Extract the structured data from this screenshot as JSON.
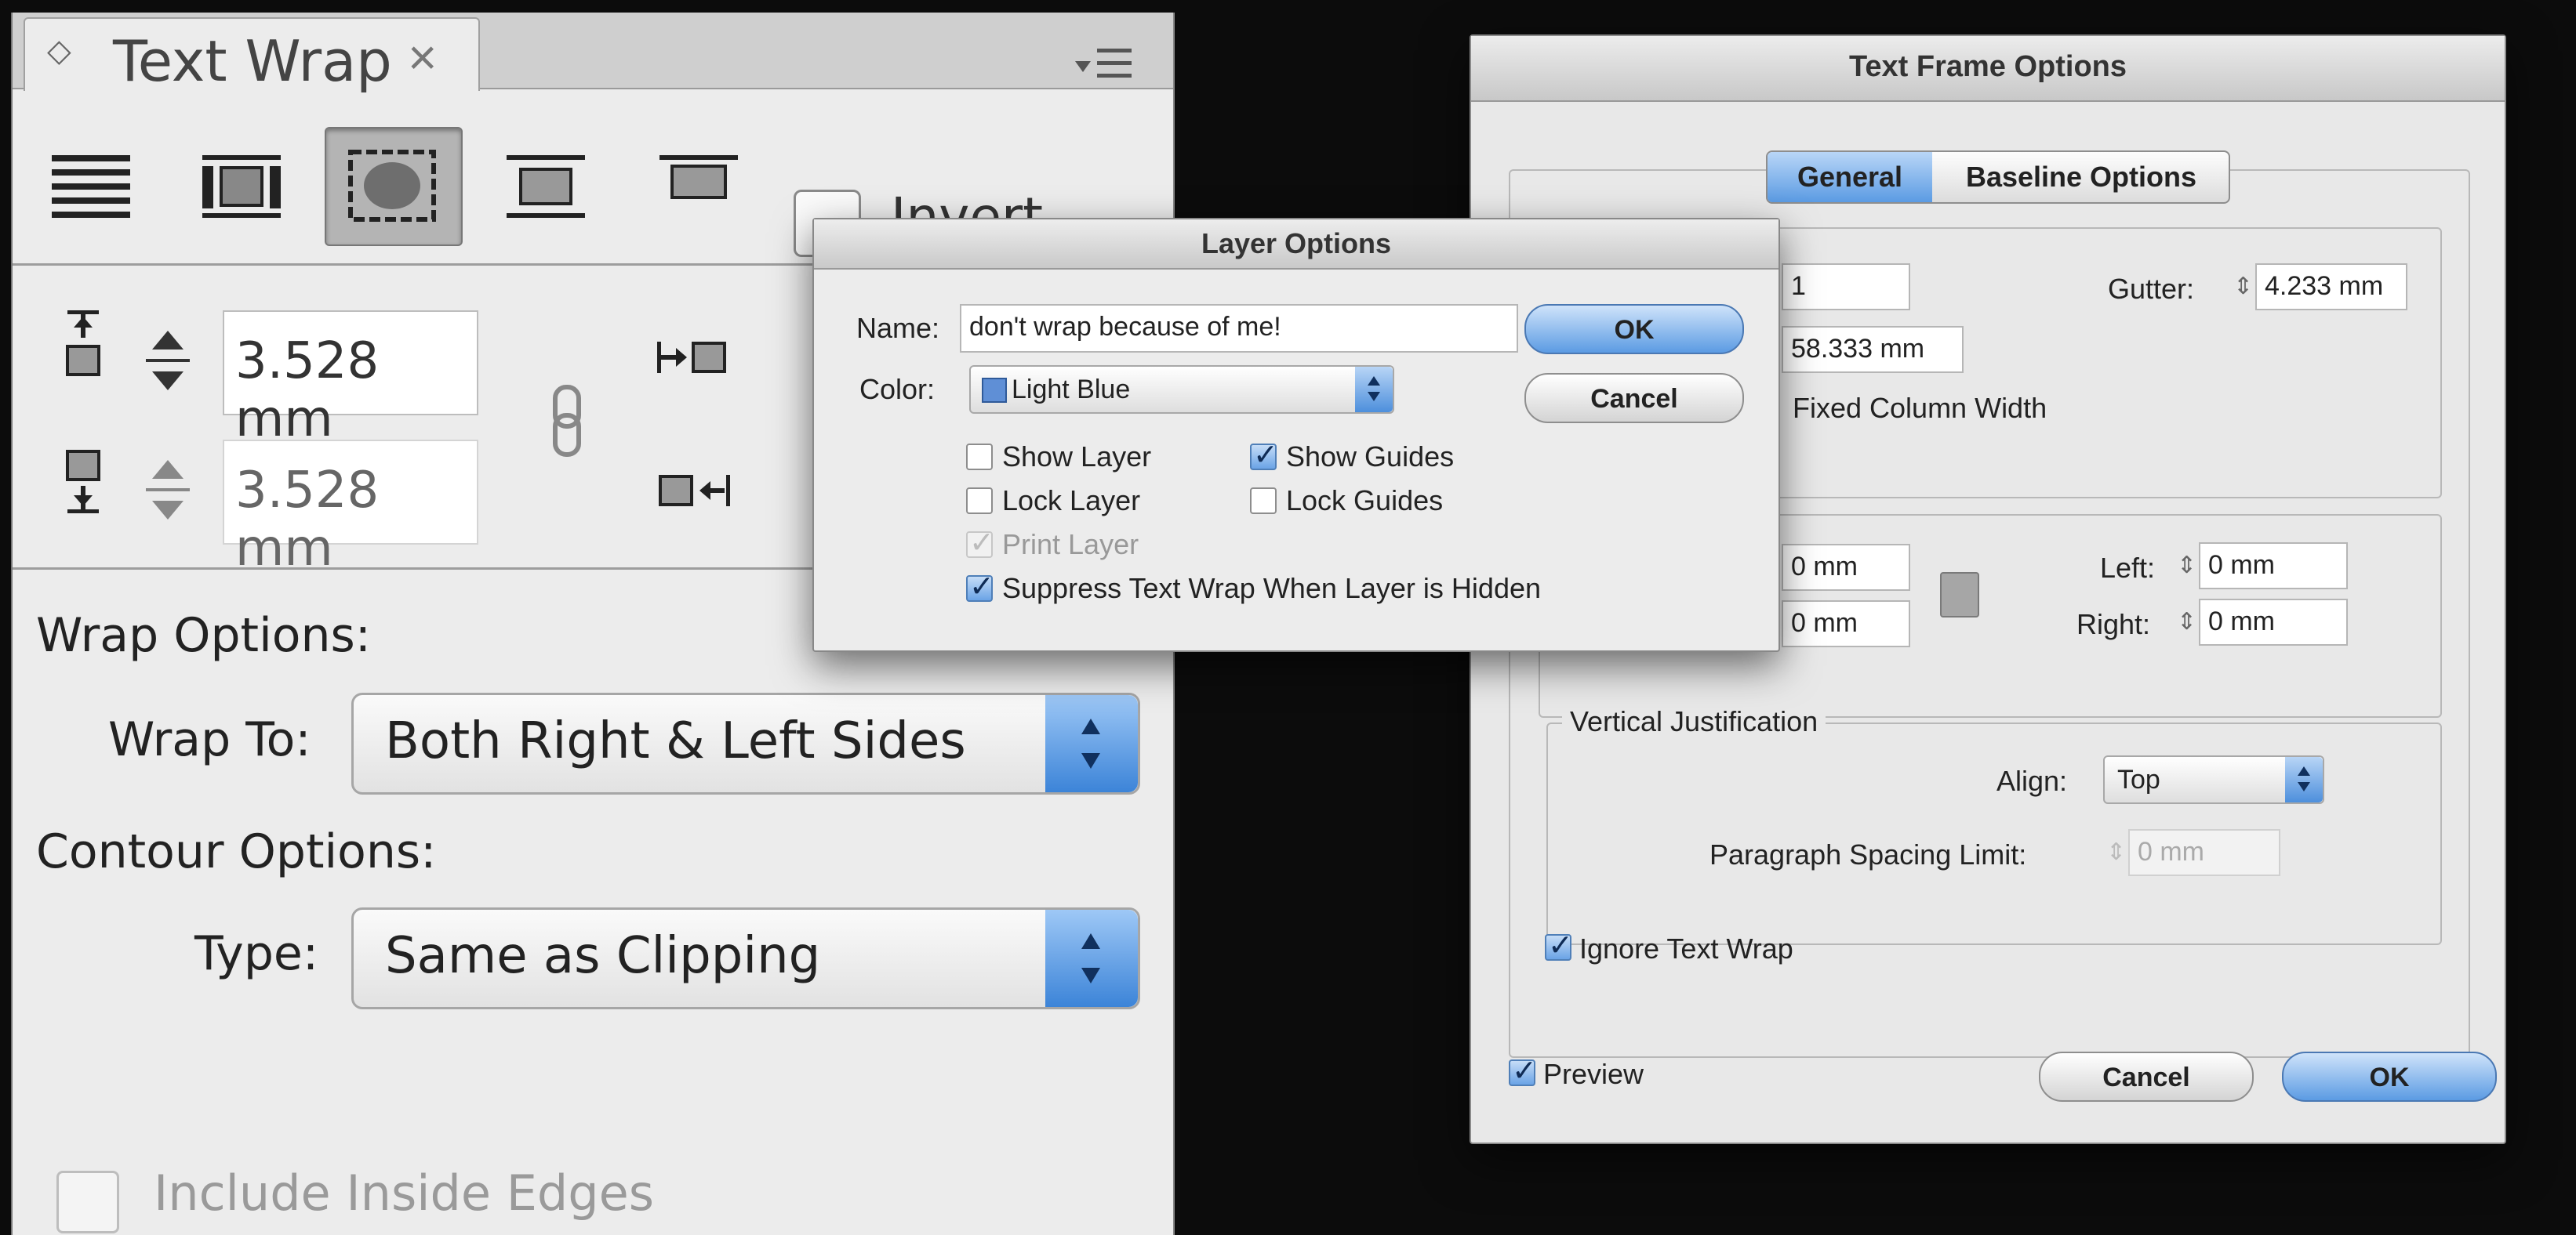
{
  "text_wrap_panel": {
    "tab_title": "Text Wrap",
    "invert_label": "Invert",
    "top_offset": "3.528 mm",
    "bottom_offset": "3.528 mm",
    "wrap_options_label": "Wrap Options:",
    "wrap_to_label": "Wrap To:",
    "wrap_to_value": "Both Right & Left Sides",
    "contour_options_label": "Contour Options:",
    "type_label": "Type:",
    "type_value": "Same as Clipping",
    "include_inside_edges_label": "Include Inside Edges"
  },
  "text_frame_options": {
    "title": "Text Frame Options",
    "tabs": [
      "General",
      "Baseline Options"
    ],
    "selected_tab": "General",
    "columns": {
      "number_value": "1",
      "width_value": "58.333 mm",
      "gutter_label": "Gutter:",
      "gutter_value": "4.233 mm",
      "fixed_column_width_label": "Fixed Column Width"
    },
    "inset": {
      "top_value": "0 mm",
      "bottom_value": "0 mm",
      "left_label": "Left:",
      "left_value": "0 mm",
      "right_label": "Right:",
      "right_value": "0 mm"
    },
    "vertical_justification": {
      "group_label": "Vertical Justification",
      "align_label": "Align:",
      "align_value": "Top",
      "paragraph_spacing_label": "Paragraph Spacing Limit:",
      "paragraph_spacing_value": "0 mm"
    },
    "ignore_text_wrap_label": "Ignore Text Wrap",
    "preview_label": "Preview",
    "cancel_label": "Cancel",
    "ok_label": "OK"
  },
  "layer_options": {
    "title": "Layer Options",
    "name_label": "Name:",
    "name_value": "don't wrap because of me!",
    "color_label": "Color:",
    "color_value": "Light Blue",
    "color_swatch": "#5f8fd6",
    "show_layer_label": "Show Layer",
    "show_guides_label": "Show Guides",
    "lock_layer_label": "Lock Layer",
    "lock_guides_label": "Lock Guides",
    "print_layer_label": "Print Layer",
    "suppress_label": "Suppress Text Wrap When Layer is Hidden",
    "ok_label": "OK",
    "cancel_label": "Cancel"
  },
  "colors": {
    "accent_blue": "#5b9be3",
    "background": "#0c0c0c"
  }
}
